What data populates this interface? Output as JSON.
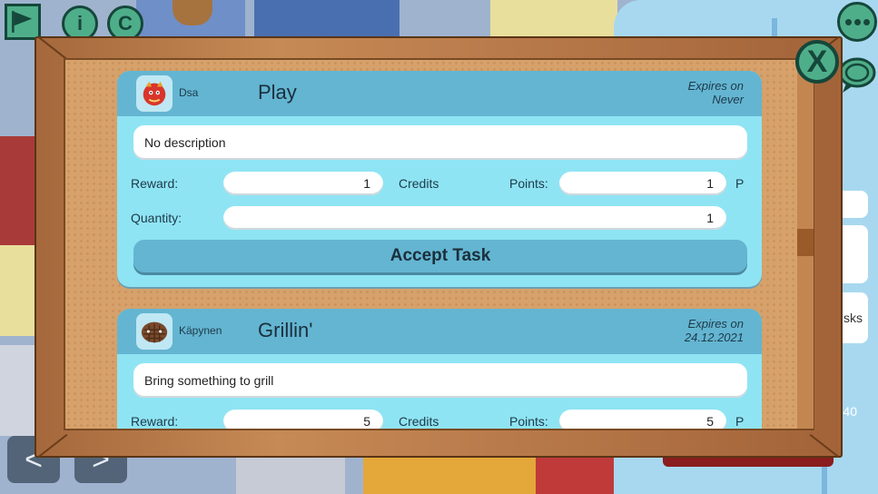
{
  "hud": {
    "flag_icon": "flag-icon",
    "info_icon": "info-icon",
    "info_glyph": "i",
    "credits_icon": "credits-icon",
    "credits_glyph": "C",
    "nav_prev": "<",
    "nav_next": ">"
  },
  "side_panel": {
    "tab_label": "sks",
    "count_label": "40"
  },
  "board": {
    "close_glyph": "X",
    "tasks": [
      {
        "creator": "Dsa",
        "title": "Play",
        "expires_label": "Expires on",
        "expires_value": "Never",
        "description": "No description",
        "reward_label": "Reward:",
        "reward_value": "1",
        "reward_unit": "Credits",
        "points_label": "Points:",
        "points_value": "1",
        "points_unit": "P",
        "quantity_label": "Quantity:",
        "quantity_value": "1",
        "accept_label": "Accept Task"
      },
      {
        "creator": "Käpynen",
        "title": "Grillin'",
        "expires_label": "Expires on",
        "expires_value": "24.12.2021",
        "description": "Bring something to grill",
        "reward_label": "Reward:",
        "reward_value": "5",
        "reward_unit": "Credits",
        "points_label": "Points:",
        "points_value": "5",
        "points_unit": "P"
      }
    ]
  },
  "colors": {
    "card_bg": "#8fe4f3",
    "card_header": "#64b5d1",
    "hud_green": "#4fae8a",
    "hud_dark": "#15473a",
    "frame_wood": "#b8794a",
    "cork": "#d6a16b"
  }
}
